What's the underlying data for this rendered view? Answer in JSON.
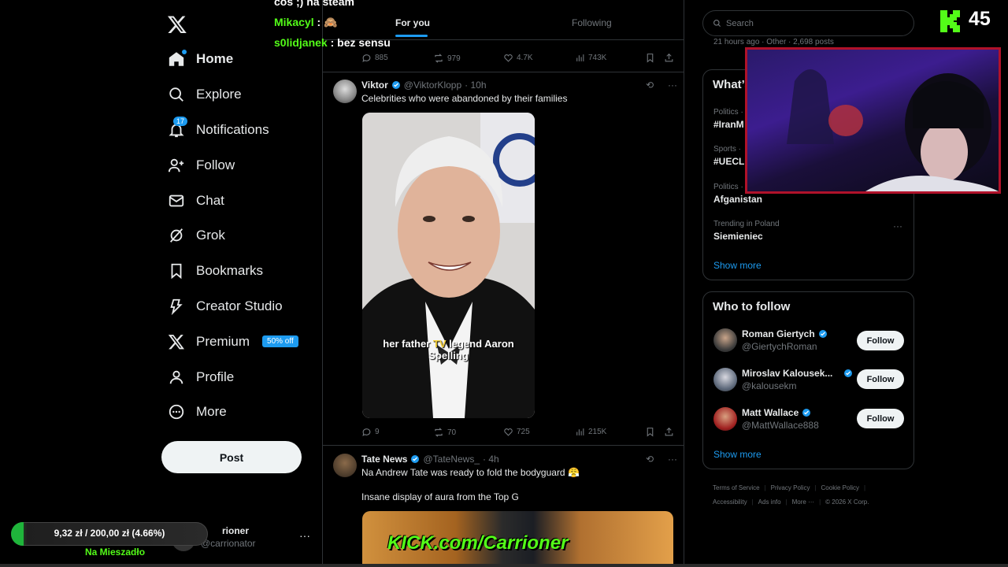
{
  "nav": {
    "items": [
      {
        "label": "Home",
        "icon": "home-icon",
        "active": true
      },
      {
        "label": "Explore",
        "icon": "search-icon"
      },
      {
        "label": "Notifications",
        "icon": "bell-icon",
        "badge": "17"
      },
      {
        "label": "Follow",
        "icon": "person-plus-icon"
      },
      {
        "label": "Chat",
        "icon": "envelope-icon"
      },
      {
        "label": "Grok",
        "icon": "grok-icon"
      },
      {
        "label": "Bookmarks",
        "icon": "bookmark-icon"
      },
      {
        "label": "Creator Studio",
        "icon": "creator-studio-icon"
      },
      {
        "label": "Premium",
        "icon": "x-logo-icon",
        "badge": "50% off"
      },
      {
        "label": "Profile",
        "icon": "person-icon"
      },
      {
        "label": "More",
        "icon": "more-circle-icon"
      }
    ],
    "post_label": "Post",
    "account": {
      "name": "rioner",
      "handle": "@carrionator",
      "more": "···"
    }
  },
  "tabs": {
    "for_you": "For you",
    "following": "Following"
  },
  "prev_tweet_actions": {
    "replies": "885",
    "reposts": "979",
    "likes": "4.7K",
    "views": "743K"
  },
  "tweets": [
    {
      "name": "Viktor",
      "handle": "@ViktorKlopp",
      "time": "· 10h",
      "text": "Celebrities who were abandoned by their families",
      "image_caption_pre": "her father ",
      "image_caption_hl": "TV",
      "image_caption_post": " legend Aaron Spelling",
      "actions": {
        "replies": "9",
        "reposts": "70",
        "likes": "725",
        "views": "215K"
      }
    },
    {
      "name": "Tate News",
      "handle": "@TateNews_",
      "time": "· 4h",
      "text": "Na Andrew Tate was ready to fold the bodyguard 😤",
      "text2": "Insane display of aura from the Top G"
    }
  ],
  "search": {
    "placeholder": "Search"
  },
  "trends": {
    "top_meta": "21 hours ago · Other · 2,698 posts",
    "title": "What’s happening",
    "items": [
      {
        "category": "Politics ·",
        "name": "#IranM"
      },
      {
        "category": "Sports ·",
        "name": "#UECL"
      },
      {
        "category": "Politics ·",
        "name": "Afganistan"
      },
      {
        "category": "Trending in Poland",
        "name": "Siemieniec"
      }
    ],
    "show_more": "Show more"
  },
  "who_to_follow": {
    "title": "Who to follow",
    "users": [
      {
        "name": "Roman Giertych",
        "handle": "@GiertychRoman",
        "button": "Follow"
      },
      {
        "name": "Miroslav Kalousek...",
        "handle": "@kalousekm",
        "button": "Follow"
      },
      {
        "name": "Matt Wallace",
        "handle": "@MattWallace888",
        "button": "Follow"
      }
    ],
    "show_more": "Show more"
  },
  "footer": {
    "links_row1": [
      "Terms of Service",
      "Privacy Policy",
      "Cookie Policy"
    ],
    "links_row2": [
      "Accessibility",
      "Ads info",
      "More ···",
      "© 2026 X Corp."
    ]
  },
  "stream": {
    "chat": [
      {
        "user": "cos ;) na steam",
        "msg": ""
      },
      {
        "user": "Mikacyl",
        "msg": " : 🙈"
      },
      {
        "user": "s0lidjanek",
        "msg": " : bez sensu"
      }
    ],
    "viewer_count": "45",
    "goal": {
      "text": "9,32 zł / 200,00 zł (4.66%)",
      "fraction": 0.0466,
      "label": "Na Mieszadło"
    },
    "kick_overlay": "KICK.com/Carrioner"
  },
  "colors": {
    "accent": "#1d9bf0",
    "kick_green": "#53fc18",
    "border": "#2f3336"
  }
}
